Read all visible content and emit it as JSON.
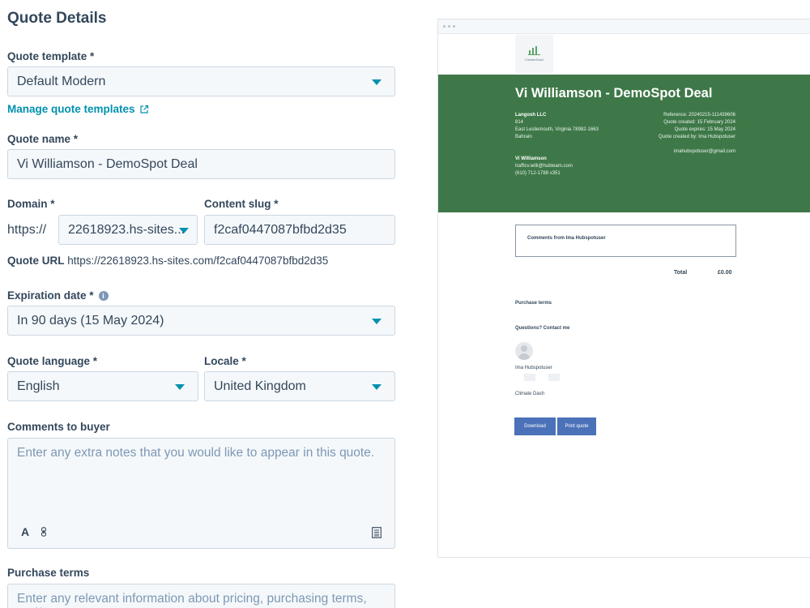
{
  "form": {
    "heading": "Quote Details",
    "template": {
      "label": "Quote template *",
      "value": "Default Modern"
    },
    "manage_link": "Manage quote templates",
    "name": {
      "label": "Quote name *",
      "value": "Vi Williamson - DemoSpot Deal"
    },
    "domain": {
      "label": "Domain *",
      "prefix": "https://",
      "value": "22618923.hs-sites..."
    },
    "slug": {
      "label": "Content slug *",
      "value": "f2caf0447087bfbd2d35"
    },
    "quote_url": {
      "label": "Quote URL",
      "value": "https://22618923.hs-sites.com/f2caf0447087bfbd2d35"
    },
    "expiration": {
      "label": "Expiration date *",
      "value": "In 90 days (15 May 2024)"
    },
    "language": {
      "label": "Quote language *",
      "value": "English"
    },
    "locale": {
      "label": "Locale *",
      "value": "United Kingdom"
    },
    "comments": {
      "label": "Comments to buyer",
      "placeholder": "Enter any extra notes that you would like to appear in this quote.",
      "tool_text": "A"
    },
    "purchase_terms": {
      "label": "Purchase terms",
      "placeholder": "Enter any relevant information about pricing, purchasing terms, and/or"
    }
  },
  "preview": {
    "logo_text": "ClimateDash",
    "title": "Vi Williamson - DemoSpot Deal",
    "company": "Langosh LLC",
    "address1": "814",
    "address2": "East Lesliemouth, Virginia 78982-1663",
    "address3": "Bahrain",
    "contact_name": "Vi Williamson",
    "contact_email": "trafficv.willi@hubteam.com",
    "contact_phone": "(610) 712-1788 x351",
    "reference": "Reference: 20240215-111439606",
    "created": "Quote created: 15 February 2024",
    "expires": "Quote expires: 15 May 2024",
    "created_by": "Quote created by: Ima Hubspotuser",
    "owner_email": "imahubspotuser@gmail.com",
    "comments_heading": "Comments from Ima Hubspotuser",
    "total_label": "Total",
    "total_value": "£0.00",
    "purchase_terms": "Purchase terms",
    "questions": "Questions? Contact me",
    "owner_name": "Ima Hubspotuser",
    "company_footer": "Climate Dash",
    "download": "Download",
    "print": "Print quote"
  },
  "colors": {
    "accent": "#0091ae",
    "header_green": "#3e7848",
    "button_blue": "#4b72b9"
  }
}
